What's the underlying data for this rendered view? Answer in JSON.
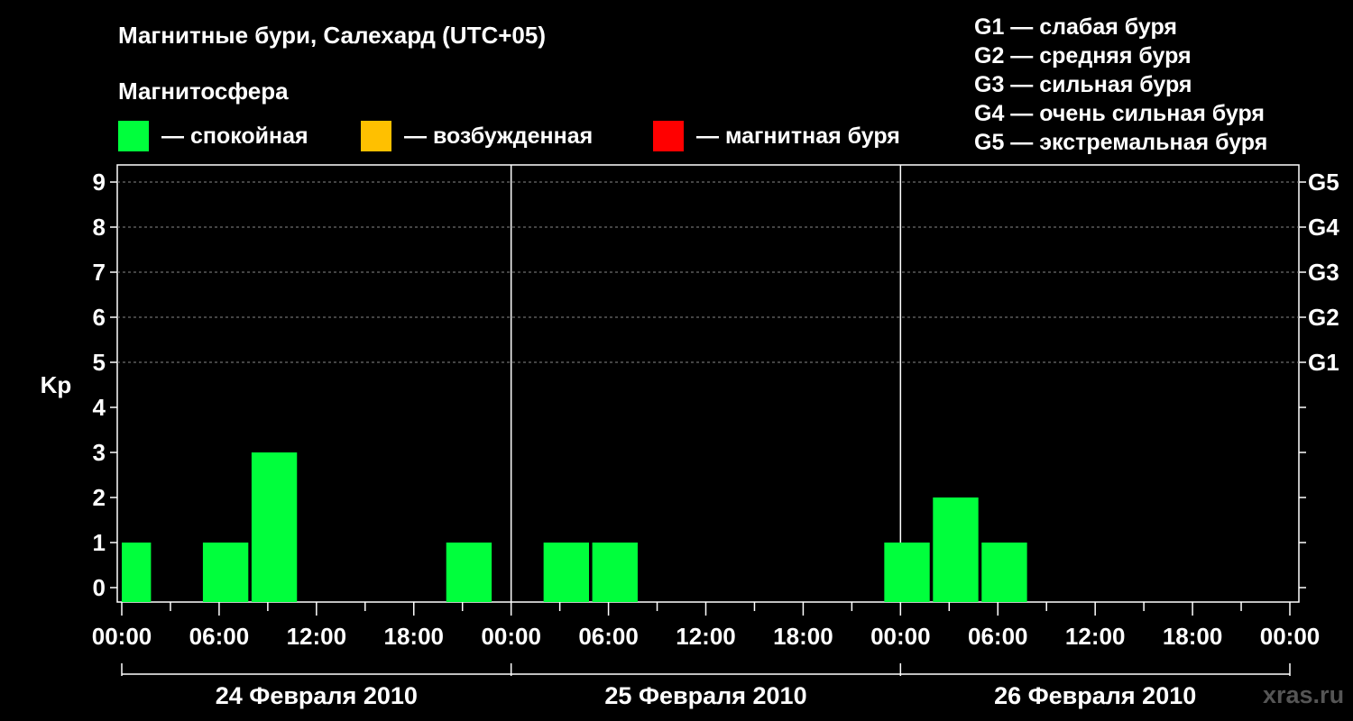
{
  "header": {
    "title": "Магнитные бури, Салехард (UTC+05)",
    "subtitle": "Магнитосфера"
  },
  "legend": [
    {
      "label": "— спокойная",
      "color": "#00ff3c"
    },
    {
      "label": "— возбужденная",
      "color": "#ffc000"
    },
    {
      "label": "— магнитная буря",
      "color": "#ff0000"
    }
  ],
  "g_scale": [
    "G1 — слабая буря",
    "G2 — средняя буря",
    "G3 — сильная буря",
    "G4 — очень сильная буря",
    "G5 — экстремальная буря"
  ],
  "watermark": "xras.ru",
  "chart_data": {
    "type": "bar",
    "ylabel": "Kp",
    "ylim": [
      0,
      9
    ],
    "yticks": [
      0,
      1,
      2,
      3,
      4,
      5,
      6,
      7,
      8,
      9
    ],
    "right_ticks": [
      {
        "value": 5,
        "label": "G1"
      },
      {
        "value": 6,
        "label": "G2"
      },
      {
        "value": 7,
        "label": "G3"
      },
      {
        "value": 8,
        "label": "G4"
      },
      {
        "value": 9,
        "label": "G5"
      }
    ],
    "grid_levels": [
      5,
      6,
      7,
      8,
      9
    ],
    "x_hours_range": [
      0,
      72
    ],
    "xtick_labels": [
      "00:00",
      "06:00",
      "12:00",
      "18:00",
      "00:00",
      "06:00",
      "12:00",
      "18:00",
      "00:00",
      "06:00",
      "12:00",
      "18:00",
      "00:00"
    ],
    "days": [
      "24 Февраля 2010",
      "25 Февраля 2010",
      "26 Февраля 2010"
    ],
    "color": "#00ff3c",
    "bars": [
      {
        "start_hour": 0,
        "end_hour": 1.8,
        "kp": 1
      },
      {
        "start_hour": 5,
        "end_hour": 7.8,
        "kp": 1
      },
      {
        "start_hour": 8,
        "end_hour": 10.8,
        "kp": 3
      },
      {
        "start_hour": 20,
        "end_hour": 22.8,
        "kp": 1
      },
      {
        "start_hour": 26,
        "end_hour": 28.8,
        "kp": 1
      },
      {
        "start_hour": 29,
        "end_hour": 31.8,
        "kp": 1
      },
      {
        "start_hour": 47,
        "end_hour": 49.8,
        "kp": 1
      },
      {
        "start_hour": 50,
        "end_hour": 52.8,
        "kp": 2
      },
      {
        "start_hour": 53,
        "end_hour": 55.8,
        "kp": 1
      }
    ]
  }
}
